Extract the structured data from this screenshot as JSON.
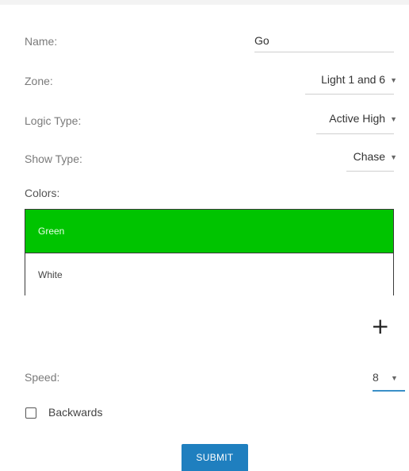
{
  "form": {
    "name": {
      "label": "Name:",
      "value": "Go"
    },
    "zone": {
      "label": "Zone:",
      "value": "Light 1 and 6"
    },
    "logic_type": {
      "label": "Logic Type:",
      "value": "Active High"
    },
    "show_type": {
      "label": "Show Type:",
      "value": "Chase"
    },
    "colors": {
      "label": "Colors:",
      "items": [
        {
          "label": "Green",
          "color": "#00c400"
        },
        {
          "label": "White",
          "color": "#ffffff"
        }
      ],
      "add_icon": "plus-icon",
      "add_glyph": "+"
    },
    "speed": {
      "label": "Speed:",
      "value": "8"
    },
    "backwards": {
      "label": "Backwards",
      "checked": false
    },
    "submit_label": "SUBMIT"
  },
  "icons": {
    "dropdown": "caret-down-icon",
    "caret_glyph": "▼"
  },
  "theme": {
    "accent": "#1f7fbf",
    "green": "#00c400"
  }
}
